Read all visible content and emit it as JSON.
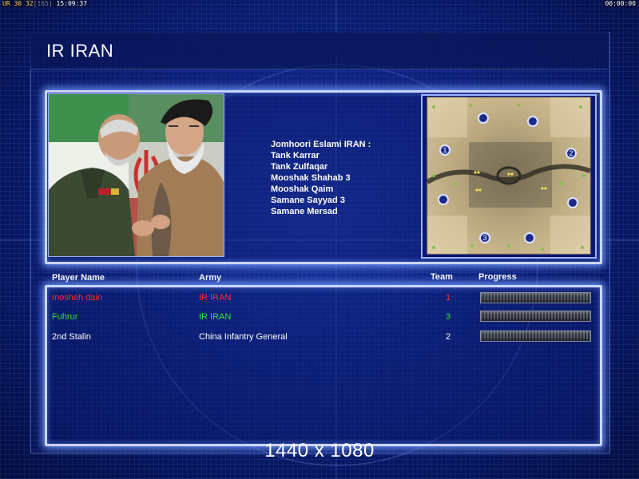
{
  "status_bar": {
    "left_label": "UR",
    "left_value_a": "30",
    "left_value_b": "32",
    "left_bracket": "165",
    "left_time": "15:09:37",
    "right_time": "00:00:00"
  },
  "screen": {
    "title": "IR IRAN",
    "resolution": "1440 x 1080"
  },
  "description": {
    "lines": [
      "Jomhoori Eslami IRAN :",
      "Tank Karrar",
      "Tank Zulfaqar",
      "Mooshak Shahab 3",
      "Mooshak Qaim",
      "Samane Sayyad 3",
      "Samane Mersad"
    ]
  },
  "minimap": {
    "start_positions": [
      "1",
      "2",
      "3"
    ]
  },
  "table": {
    "headers": {
      "player_name": "Player Name",
      "army": "Army",
      "team": "Team",
      "progress": "Progress"
    },
    "rows": [
      {
        "name": "mosheh dain",
        "army": "IR IRAN",
        "team": "1",
        "color": "#ff2a2a",
        "progress": 0.0
      },
      {
        "name": "Fuhrur",
        "army": "IR IRAN",
        "team": "3",
        "color": "#36e03a",
        "progress": 0.0
      },
      {
        "name": "2nd Stalin",
        "army": "China Infantry General",
        "team": "2",
        "color": "#ffffff",
        "progress": 0.0
      }
    ]
  }
}
